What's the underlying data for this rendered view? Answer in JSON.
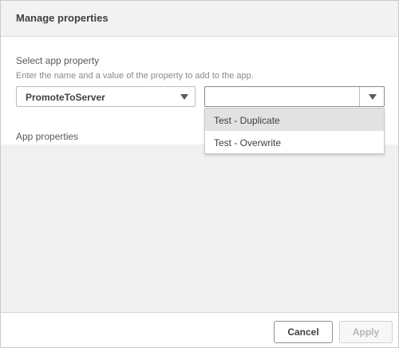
{
  "dialog": {
    "title": "Manage properties",
    "section_label": "Select app property",
    "hint": "Enter the name and a value of the property to add to the app.",
    "property_select": {
      "selected": "PromoteToServer"
    },
    "value_select": {
      "selected": "",
      "options": [
        "Test - Duplicate",
        "Test - Overwrite"
      ],
      "highlighted_index": 0
    },
    "app_properties_label": "App properties",
    "buttons": {
      "cancel": "Cancel",
      "apply": "Apply"
    }
  },
  "icons": {
    "dropdown_caret": "chevron-down-icon"
  },
  "colors": {
    "header_bg": "#f2f2f2",
    "list_area_bg": "#f0f0f0",
    "highlight": "#e2e2e2"
  }
}
